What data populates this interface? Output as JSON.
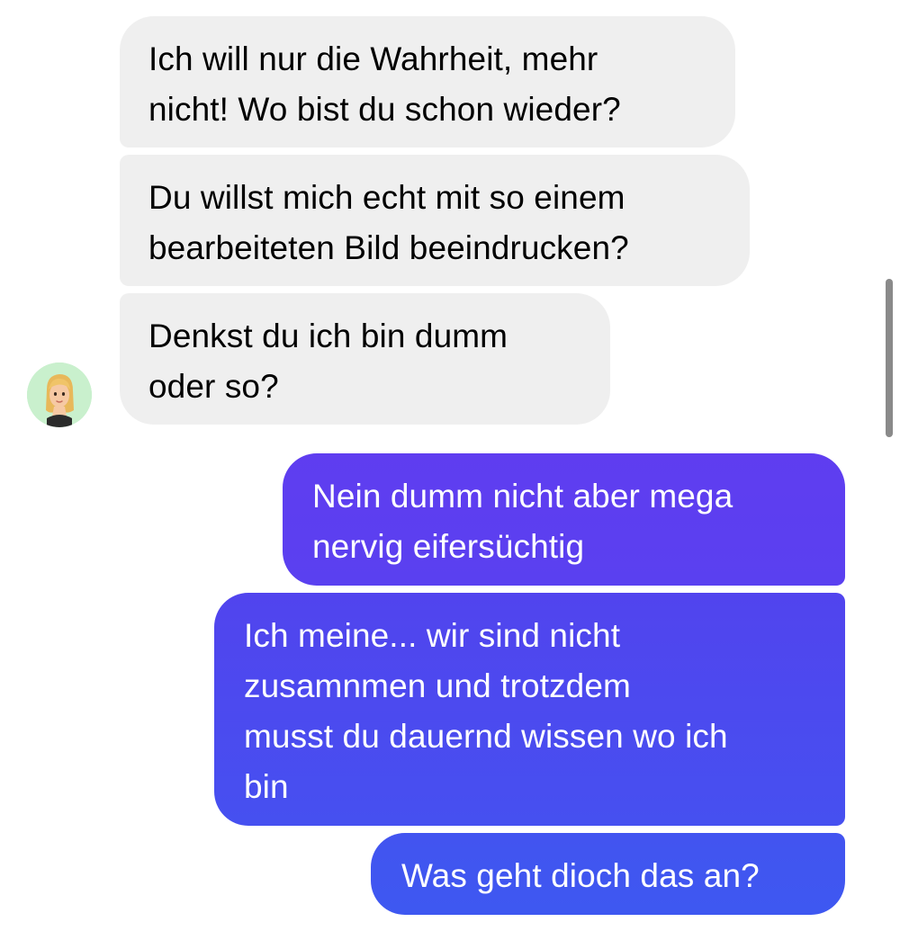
{
  "conversation": {
    "messages": [
      {
        "direction": "incoming",
        "text": "Ich will nur die Wahrheit, mehr\nnicht! Wo bist du schon wieder?"
      },
      {
        "direction": "incoming",
        "text": "Du willst mich echt mit so einem\nbearbeiteten Bild beeindrucken?"
      },
      {
        "direction": "incoming",
        "text": "Denkst du ich bin dumm\noder so?"
      },
      {
        "direction": "outgoing",
        "text": "Nein dumm nicht aber mega\nnervig eifersüchtig"
      },
      {
        "direction": "outgoing",
        "text": "Ich meine... wir sind nicht\nzusamnmen und trotzdem\nmusst du dauernd wissen wo ich\nbin"
      },
      {
        "direction": "outgoing",
        "text": "Was geht dioch das an?"
      }
    ],
    "contact_avatar": "memoji-avatar-icon"
  },
  "colors": {
    "incoming_bubble": "#efefef",
    "outgoing_gradient_top": "#5f3df0",
    "outgoing_gradient_bottom": "#3e58f1",
    "avatar_background": "#c9f0cd"
  }
}
